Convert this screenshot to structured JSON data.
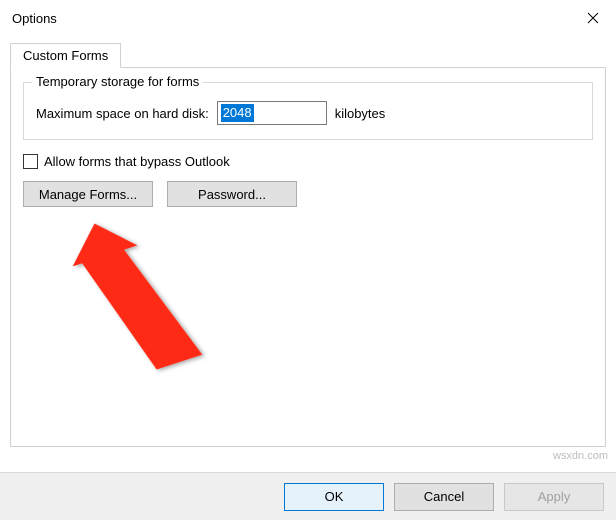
{
  "window": {
    "title": "Options"
  },
  "tabs": {
    "custom_forms": "Custom Forms"
  },
  "group": {
    "legend": "Temporary storage for forms",
    "max_space_label": "Maximum space on hard disk:",
    "max_space_value": "2048",
    "unit": "kilobytes"
  },
  "checkbox": {
    "allow_bypass": "Allow forms that bypass Outlook"
  },
  "buttons": {
    "manage_forms": "Manage Forms...",
    "password": "Password..."
  },
  "footer": {
    "ok": "OK",
    "cancel": "Cancel",
    "apply": "Apply"
  },
  "watermark": "wsxdn.com"
}
